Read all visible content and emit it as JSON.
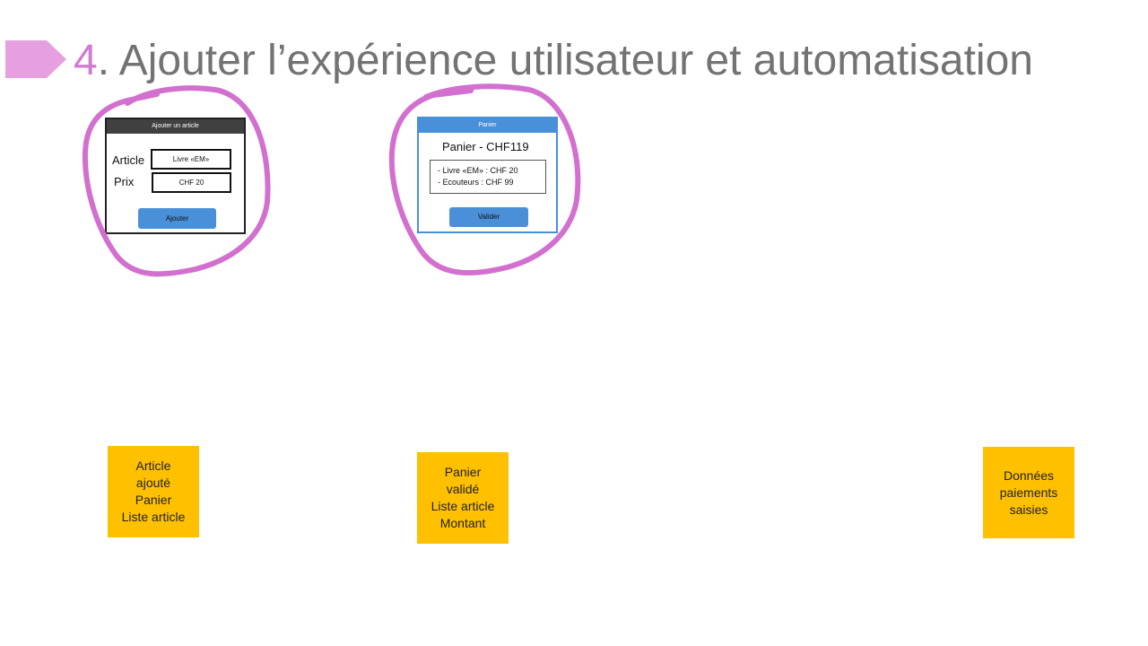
{
  "title": {
    "number": "4",
    "text": ". Ajouter l’expérience utilisateur et automatisation"
  },
  "colors": {
    "accent": "#d17bd1",
    "arrow": "#e6a0df",
    "sticky": "#ffc000",
    "button": "#4a90d9",
    "dark_bar": "#404040"
  },
  "add_article_mock": {
    "header": "Ajouter un article",
    "article_label": "Article",
    "article_value": "Livre «EM»",
    "price_label": "Prix",
    "price_value": "CHF 20",
    "button": "Ajouter"
  },
  "cart_mock": {
    "header": "Panier",
    "title": "Panier - CHF119",
    "items": [
      "- Livre «EM» : CHF 20",
      "- Ecouteurs : CHF 99"
    ],
    "button": "Valider"
  },
  "stickies": [
    {
      "lines": [
        "Article",
        "ajouté",
        "Panier",
        "Liste article"
      ]
    },
    {
      "lines": [
        "Panier",
        "validé",
        "Liste article",
        "Montant"
      ]
    },
    {
      "lines": [
        "Données",
        "paiements",
        "saisies"
      ]
    }
  ]
}
